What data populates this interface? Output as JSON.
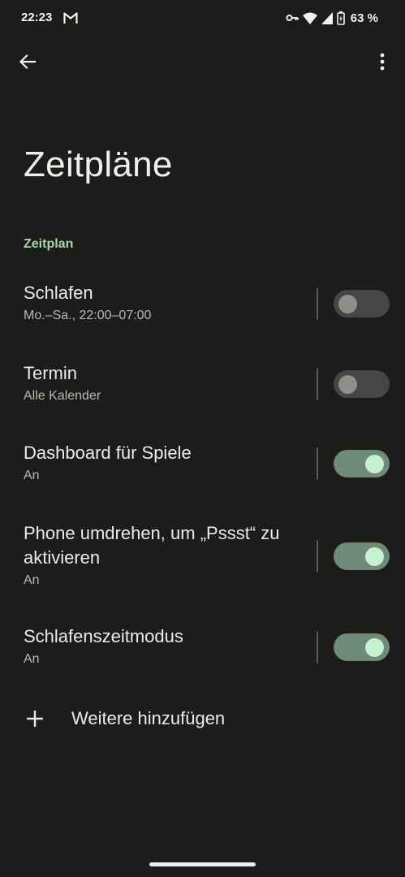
{
  "status_bar": {
    "time": "22:23",
    "battery": "63 %",
    "icons": [
      "gmail-icon",
      "vpn-key-icon",
      "wifi-icon",
      "signal-icon",
      "battery-charging-icon"
    ]
  },
  "appbar": {
    "back_icon": "arrow-back-icon",
    "menu_icon": "more-vert-icon"
  },
  "page": {
    "title": "Zeitpläne",
    "section": "Zeitplan"
  },
  "schedules": [
    {
      "title": "Schlafen",
      "subtitle": "Mo.–Sa., 22:00–07:00",
      "enabled": false
    },
    {
      "title": "Termin",
      "subtitle": "Alle Kalender",
      "enabled": false
    },
    {
      "title": "Dashboard für Spiele",
      "subtitle": "An",
      "enabled": true
    },
    {
      "title": "Phone umdrehen, um „Pssst“ zu aktivieren",
      "subtitle": "An",
      "enabled": true
    },
    {
      "title": "Schlafenszeitmodus",
      "subtitle": "An",
      "enabled": true
    }
  ],
  "add_more": {
    "label": "Weitere hinzufügen",
    "icon": "plus-icon"
  },
  "colors": {
    "background": "#1c1d1b",
    "accent": "#a6d8ab",
    "switch_on_track": "#6f8a79",
    "switch_on_thumb": "#c5f2ce",
    "switch_off_track": "#454744",
    "switch_off_thumb": "#8f908b"
  }
}
